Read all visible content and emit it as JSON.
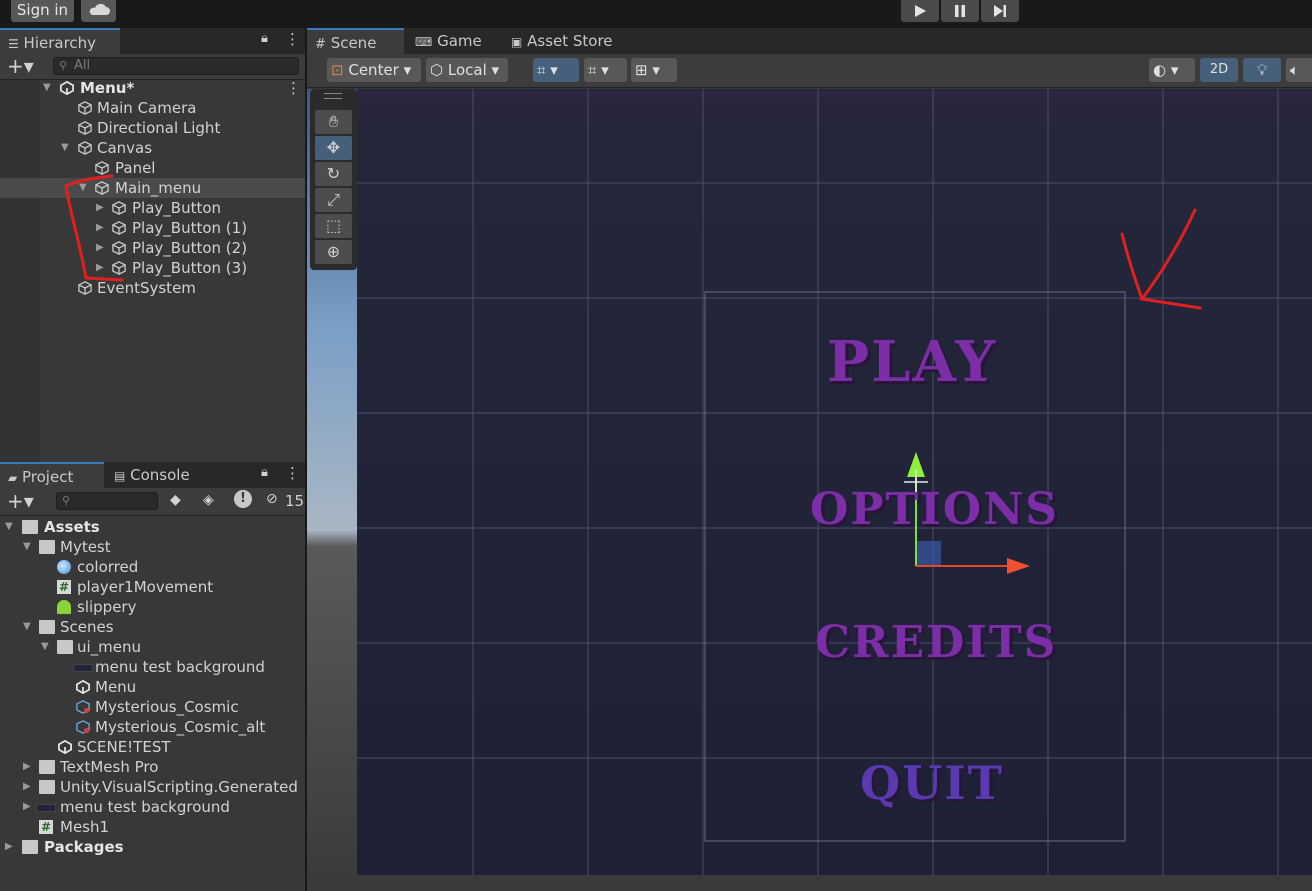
{
  "topbar": {
    "signin": "Sign in",
    "play_icon": "play-icon",
    "pause_icon": "pause-icon",
    "step_icon": "step-icon"
  },
  "hierarchy": {
    "tab": "Hierarchy",
    "search_placeholder": "All",
    "items": [
      {
        "label": "Menu*",
        "depth": 0
      },
      {
        "label": "Main Camera",
        "depth": 1
      },
      {
        "label": "Directional Light",
        "depth": 1
      },
      {
        "label": "Canvas",
        "depth": 1
      },
      {
        "label": "Panel",
        "depth": 2
      },
      {
        "label": "Main_menu",
        "depth": 2
      },
      {
        "label": "Play_Button",
        "depth": 3
      },
      {
        "label": "Play_Button (1)",
        "depth": 3
      },
      {
        "label": "Play_Button (2)",
        "depth": 3
      },
      {
        "label": "Play_Button (3)",
        "depth": 3
      },
      {
        "label": "EventSystem",
        "depth": 1
      }
    ]
  },
  "project": {
    "tabs": [
      "Project",
      "Console"
    ],
    "hidden_count": "15",
    "items": [
      {
        "label": "Assets",
        "depth": 0
      },
      {
        "label": "Mytest",
        "depth": 1
      },
      {
        "label": "colorred",
        "depth": 2
      },
      {
        "label": "player1Movement",
        "depth": 2
      },
      {
        "label": "slippery",
        "depth": 2
      },
      {
        "label": "Scenes",
        "depth": 1
      },
      {
        "label": "ui_menu",
        "depth": 2
      },
      {
        "label": "menu test background",
        "depth": 3
      },
      {
        "label": "Menu",
        "depth": 3
      },
      {
        "label": "Mysterious_Cosmic",
        "depth": 3
      },
      {
        "label": "Mysterious_Cosmic_alt",
        "depth": 3
      },
      {
        "label": "SCENE!TEST",
        "depth": 2
      },
      {
        "label": "TextMesh Pro",
        "depth": 1
      },
      {
        "label": "Unity.VisualScripting.Generated",
        "depth": 1
      },
      {
        "label": "menu test background",
        "depth": 1
      },
      {
        "label": "Mesh1",
        "depth": 1
      },
      {
        "label": "Packages",
        "depth": 0
      }
    ]
  },
  "scene": {
    "tabs": [
      "Scene",
      "Game",
      "Asset Store"
    ],
    "pivot": "Center",
    "space": "Local",
    "mode_2d": "2D",
    "menu_texts": [
      "PLAY",
      "OPTIONS",
      "CREDITS",
      "QUIT"
    ]
  },
  "colors": {
    "accent": "#46607c",
    "menu_text": "#7c2ea6",
    "annotation": "#e02020"
  }
}
